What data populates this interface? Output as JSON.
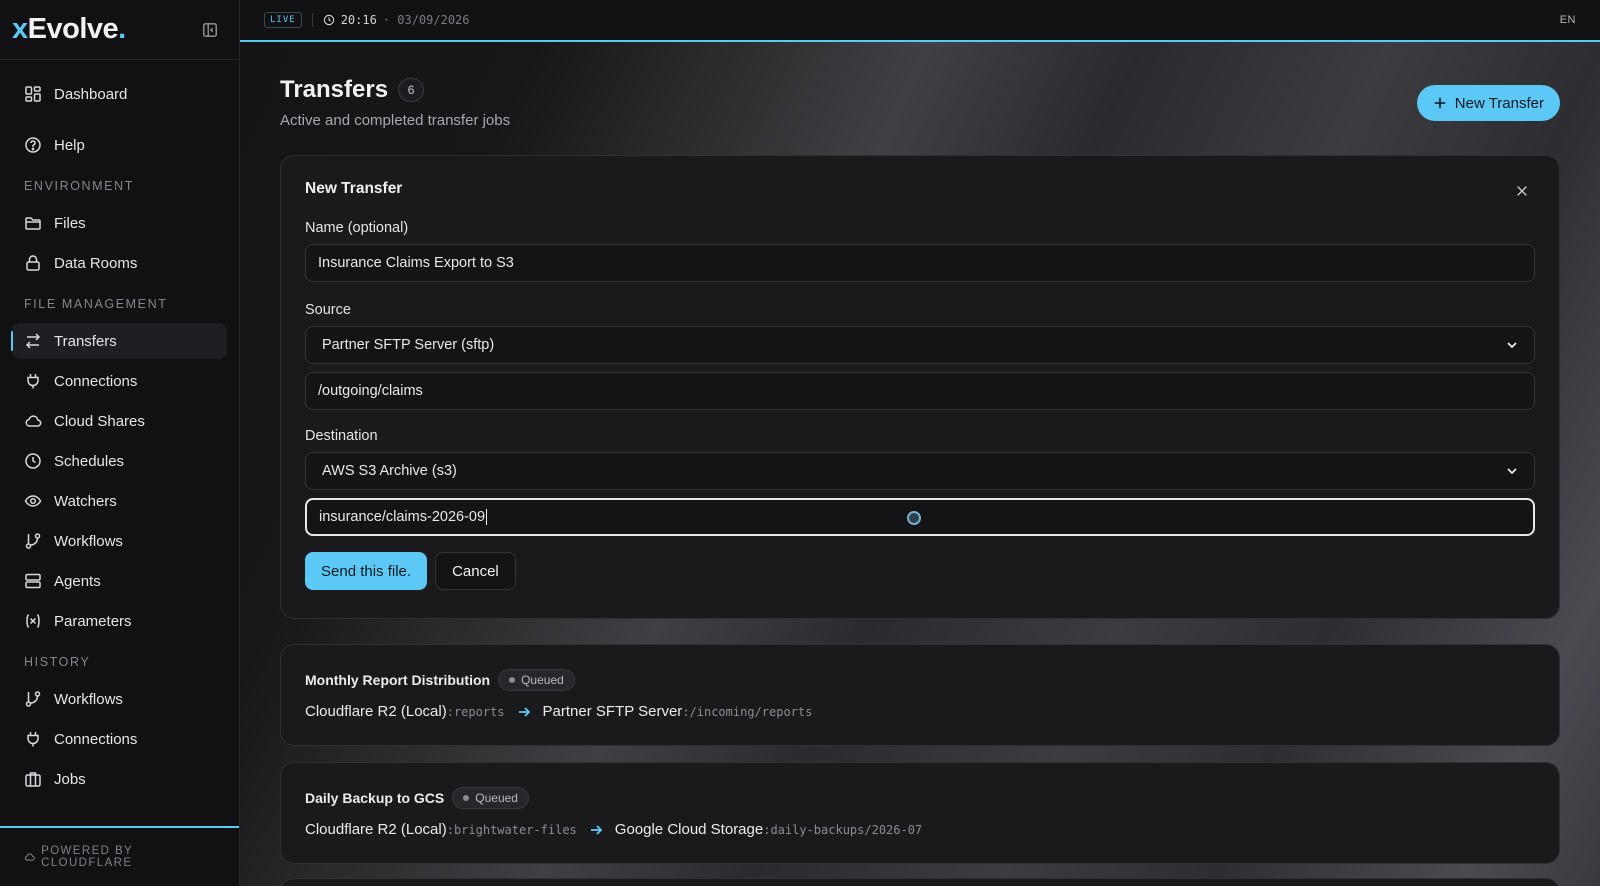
{
  "brand": {
    "x": "x",
    "rest": "Evolve",
    "dot": "."
  },
  "nav": {
    "top": [
      {
        "label": "Dashboard",
        "icon": "dashboard-icon"
      },
      {
        "label": "Help",
        "icon": "help-icon"
      }
    ],
    "sections": [
      {
        "title": "ENVIRONMENT",
        "items": [
          {
            "label": "Files",
            "icon": "folder-icon"
          },
          {
            "label": "Data Rooms",
            "icon": "lock-icon"
          }
        ]
      },
      {
        "title": "FILE MANAGEMENT",
        "items": [
          {
            "label": "Transfers",
            "icon": "transfer-icon",
            "active": true
          },
          {
            "label": "Connections",
            "icon": "plug-icon"
          },
          {
            "label": "Cloud Shares",
            "icon": "cloud-icon"
          },
          {
            "label": "Schedules",
            "icon": "clock-icon"
          },
          {
            "label": "Watchers",
            "icon": "eye-icon"
          },
          {
            "label": "Workflows",
            "icon": "workflow-icon"
          },
          {
            "label": "Agents",
            "icon": "server-icon"
          },
          {
            "label": "Parameters",
            "icon": "variable-icon"
          }
        ]
      },
      {
        "title": "HISTORY",
        "items": [
          {
            "label": "Workflows",
            "icon": "workflow-icon"
          },
          {
            "label": "Connections",
            "icon": "plug-icon"
          },
          {
            "label": "Jobs",
            "icon": "briefcase-icon"
          }
        ]
      }
    ]
  },
  "footer": {
    "label": "POWERED BY CLOUDFLARE"
  },
  "topbar": {
    "live": "LIVE",
    "time": "20:16",
    "date": "· 03/09/2026",
    "lang": "EN"
  },
  "page": {
    "title": "Transfers",
    "count": "6",
    "subtitle": "Active and completed transfer jobs",
    "new_button": "New Transfer"
  },
  "form": {
    "title": "New Transfer",
    "name_label": "Name (optional)",
    "name_value": "Insurance Claims Export to S3",
    "source_label": "Source",
    "source_value": "Partner SFTP Server (sftp)",
    "source_path": "/outgoing/claims",
    "dest_label": "Destination",
    "dest_value": "AWS S3 Archive (s3)",
    "dest_path": "insurance/claims-2026-09",
    "submit": "Send this file.",
    "cancel": "Cancel"
  },
  "jobs": [
    {
      "name": "Monthly Report Distribution",
      "status": "Queued",
      "from": "Cloudflare R2 (Local)",
      "from_path": ":reports",
      "to": "Partner SFTP Server",
      "to_path": ":/incoming/reports"
    },
    {
      "name": "Daily Backup to GCS",
      "status": "Queued",
      "from": "Cloudflare R2 (Local)",
      "from_path": ":brightwater-files",
      "to": "Google Cloud Storage",
      "to_path": ":daily-backups/2026-07"
    }
  ],
  "colors": {
    "accent": "#5cc8f5",
    "background": "#0f0f11",
    "card": "#1a1a1d"
  }
}
